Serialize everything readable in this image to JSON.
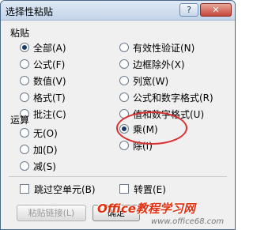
{
  "dialog": {
    "title": "选择性粘贴"
  },
  "titlebar": {
    "help_label": "?",
    "close_label": "✕"
  },
  "paste": {
    "label": "粘贴",
    "options_left": [
      "全部(A)",
      "公式(F)",
      "数值(V)",
      "格式(T)",
      "批注(C)"
    ],
    "options_right": [
      "有效性验证(N)",
      "边框除外(X)",
      "列宽(W)",
      "公式和数字格式(R)",
      "值和数字格式(U)"
    ],
    "selected": "全部(A)"
  },
  "operation": {
    "label": "运算",
    "options_left": [
      "无(O)",
      "加(D)",
      "减(S)"
    ],
    "options_right": [
      "乘(M)",
      "除(I)"
    ],
    "selected": "乘(M)"
  },
  "checks": {
    "skip_blanks": "跳过空单元(B)",
    "transpose": "转置(E)"
  },
  "buttons": {
    "paste_link": "粘贴链接(L)",
    "ok": "确定"
  },
  "watermark": {
    "brand": "Office教程学习网",
    "url": "www.office68.com"
  },
  "colors": {
    "highlight_oval": "#d83030",
    "watermark": "#e03010"
  }
}
